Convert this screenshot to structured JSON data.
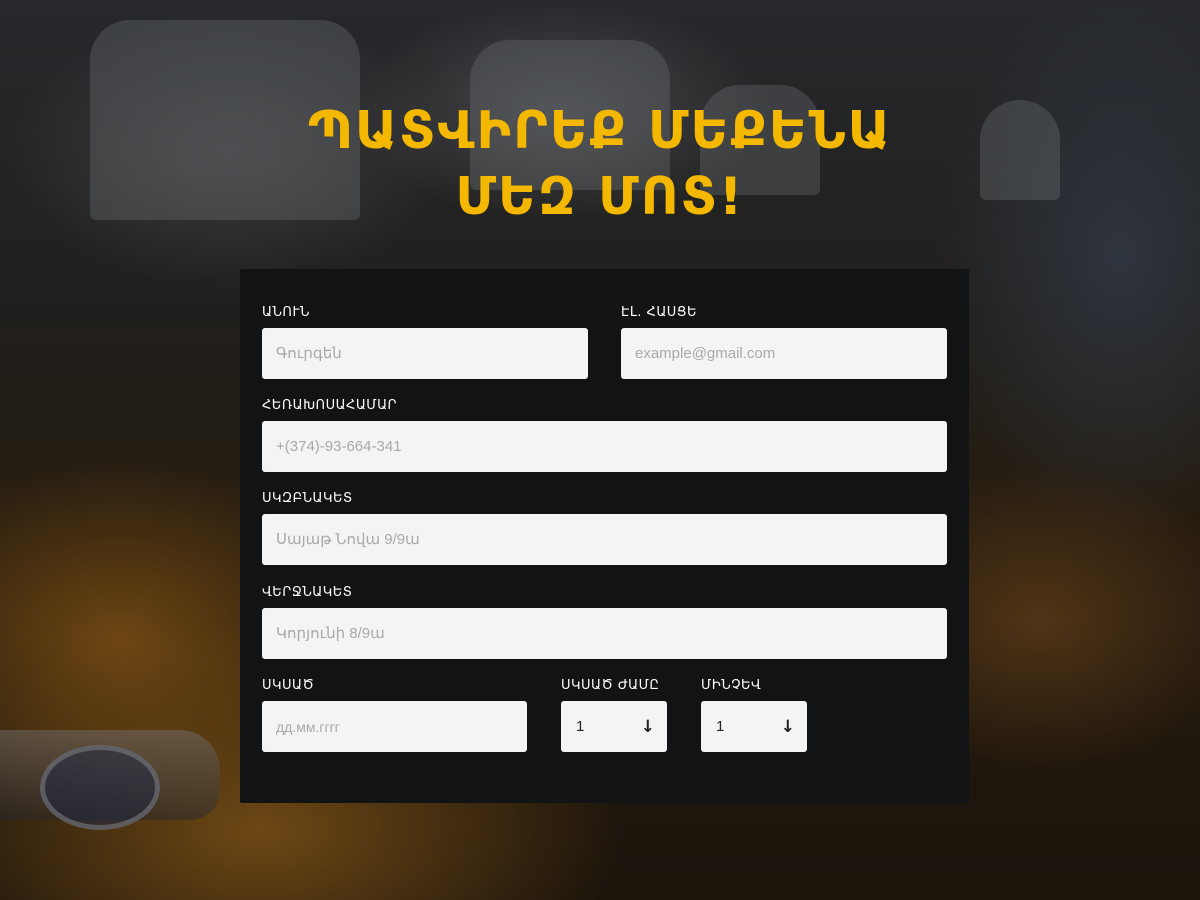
{
  "hero": {
    "title_line1": "ՊԱՏՎԻՐԵՔ ՄԵՔԵՆԱ",
    "title_line2": "ՄԵԶ ՄՈՏ!"
  },
  "form": {
    "name": {
      "label": "ԱՆՈՒՆ",
      "placeholder": "Գուրգեն"
    },
    "email": {
      "label": "ԷԼ. ՀԱՍՑԵ",
      "placeholder": "example@gmail.com"
    },
    "phone": {
      "label": "ՀԵՌԱԽՈՍԱՀԱՄԱՐ",
      "placeholder": "+(374)-93-664-341"
    },
    "start_point": {
      "label": "ՍԿԶԲՆԱԿԵՏ",
      "placeholder": "Սայաթ Նովա 9/9ա"
    },
    "end_point": {
      "label": "ՎԵՐՋՆԱԿԵՏ",
      "placeholder": "Կորյունի 8/9ա"
    },
    "start_date": {
      "label": "ՍԿՍԱԾ",
      "placeholder": "дд.мм.гггг"
    },
    "start_time": {
      "label": "ՍԿՍԱԾ ԺԱՄԸ",
      "value": "1",
      "arrow": "↓"
    },
    "until": {
      "label": "ՄԻՆՉԵՎ",
      "value": "1",
      "arrow": "↓"
    }
  },
  "colors": {
    "accent": "#f5b800",
    "card": "#121315",
    "field": "#f4f4f4"
  }
}
